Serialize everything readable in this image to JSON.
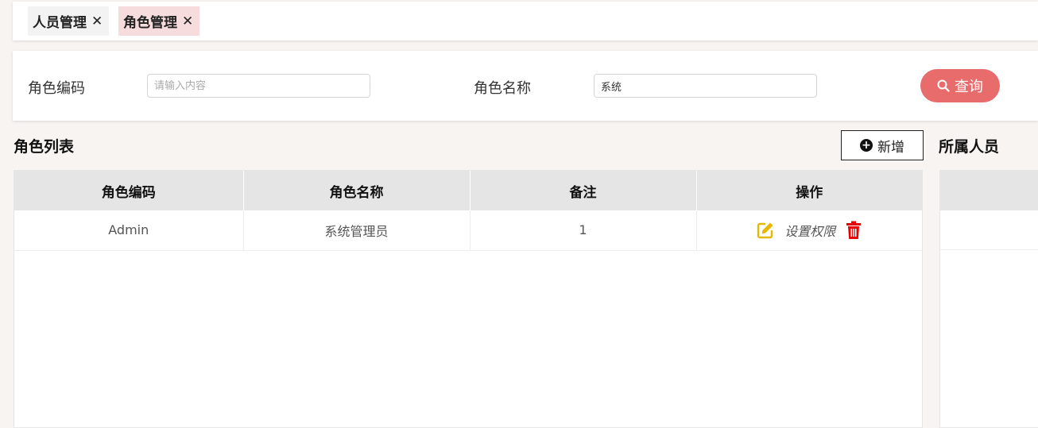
{
  "tabs": [
    {
      "label": "人员管理",
      "close": "✕"
    },
    {
      "label": "角色管理",
      "close": "✕"
    }
  ],
  "filter": {
    "code_label": "角色编码",
    "code_placeholder": "请输入内容",
    "code_value": "",
    "name_label": "角色名称",
    "name_value": "系统",
    "query_label": "查询"
  },
  "role_list": {
    "title": "角色列表",
    "add_label": "新增",
    "columns": [
      "角色编码",
      "角色名称",
      "备注",
      "操作"
    ],
    "rows": [
      {
        "code": "Admin",
        "name": "系统管理员",
        "remark": "1",
        "perm_label": "设置权限"
      }
    ]
  },
  "members": {
    "title": "所属人员"
  },
  "colors": {
    "accent": "#e86c6c",
    "active_tab_bg": "#f6dcdc",
    "edit_icon": "#e6b800",
    "delete_icon": "#e60000"
  },
  "icons": {
    "tab_close": "close-icon",
    "query": "search-icon",
    "add": "plus-circle-icon",
    "edit": "edit-icon",
    "delete": "trash-icon"
  }
}
